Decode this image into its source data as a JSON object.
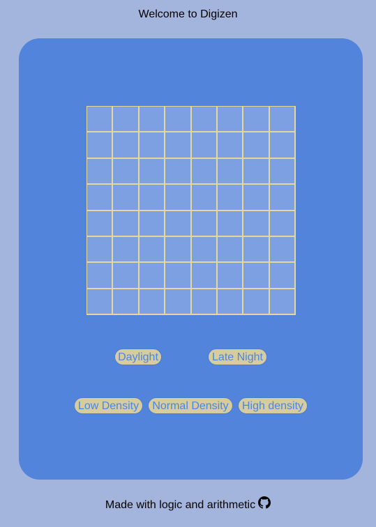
{
  "header": {
    "welcome_text": "Welcome to Digizen"
  },
  "grid": {
    "rows": 8,
    "columns": 8
  },
  "theme_buttons": [
    {
      "label": "Daylight"
    },
    {
      "label": "Late Night"
    }
  ],
  "density_buttons": [
    {
      "label": "Low Density"
    },
    {
      "label": "Normal Density"
    },
    {
      "label": "High density"
    }
  ],
  "footer": {
    "text": "Made with logic and arithmetic",
    "icon": "github-icon"
  },
  "colors": {
    "page_background": "#a3b4dd",
    "card_background": "#5284db",
    "cell_fill": "#7da0e3",
    "grid_lines": "#e6d79b",
    "button_background": "#d6cc9d",
    "button_text": "#4a86e3"
  }
}
